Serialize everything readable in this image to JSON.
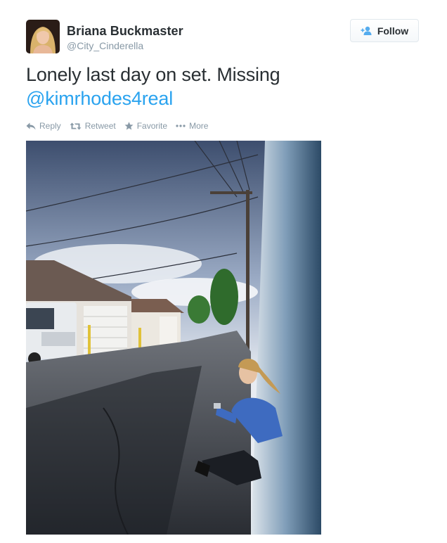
{
  "user": {
    "full_name": "Briana Buckmaster",
    "username": "@City_Cinderella"
  },
  "follow_button": {
    "label": "Follow",
    "icon": "add-user-icon"
  },
  "tweet": {
    "text": "Lonely last day on set. Missing",
    "mention": "@kimrhodes4real"
  },
  "actions": [
    {
      "label": "Reply",
      "icon": "reply-icon"
    },
    {
      "label": "Retweet",
      "icon": "retweet-icon"
    },
    {
      "label": "Favorite",
      "icon": "star-icon"
    },
    {
      "label": "More",
      "icon": "more-dots-icon"
    }
  ],
  "colors": {
    "link": "#2aa3ef",
    "text": "#292f33",
    "muted": "#8899a6"
  }
}
